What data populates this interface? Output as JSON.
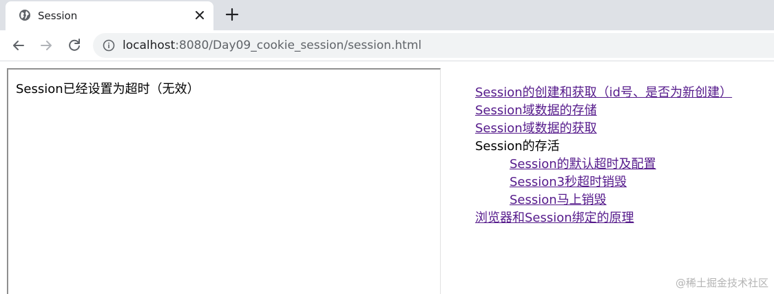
{
  "browser": {
    "tab_title": "Session",
    "url_host": "localhost",
    "url_path": ":8080/Day09_cookie_session/session.html"
  },
  "frame": {
    "text": "Session已经设置为超时（无效）"
  },
  "nav_links": [
    {
      "label": "Session的创建和获取（id号、是否为新创建）",
      "link": true
    },
    {
      "label": "Session域数据的存储",
      "link": true
    },
    {
      "label": "Session域数据的获取",
      "link": true
    },
    {
      "label": "Session的存活",
      "link": false
    },
    {
      "label": "Session的默认超时及配置",
      "link": true,
      "indent": true
    },
    {
      "label": "Session3秒超时销毁",
      "link": true,
      "indent": true
    },
    {
      "label": "Session马上销毁",
      "link": true,
      "indent": true
    },
    {
      "label": "浏览器和Session绑定的原理",
      "link": true
    }
  ],
  "watermark": "@稀土掘金技术社区",
  "colors": {
    "link": "#551a8b",
    "tabstrip": "#dee1e6",
    "omnibox": "#f1f3f4"
  },
  "icons": [
    "globe-icon",
    "close-icon",
    "plus-icon",
    "back-arrow-icon",
    "forward-arrow-icon",
    "reload-icon",
    "info-icon"
  ]
}
